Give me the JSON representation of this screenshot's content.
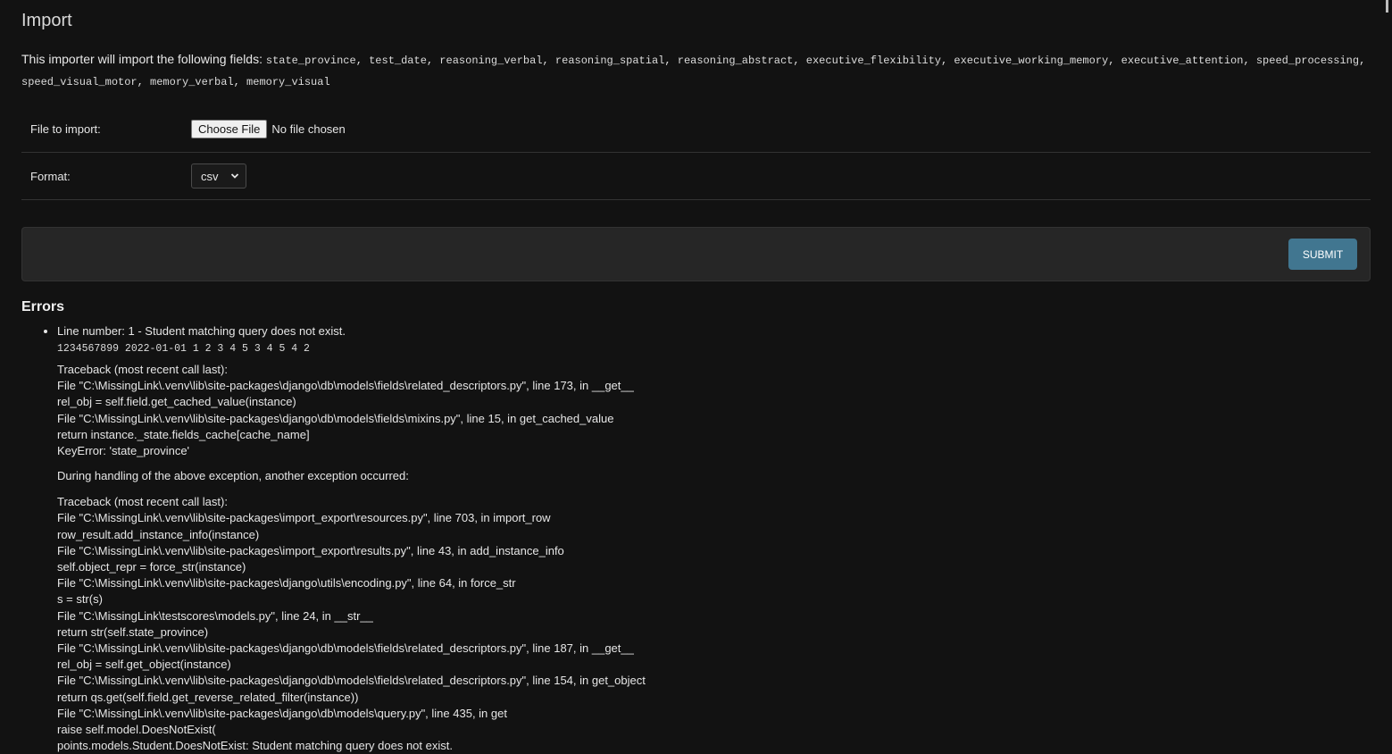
{
  "page": {
    "title": "Import"
  },
  "intro": {
    "text": "This importer will import the following fields: ",
    "fields": "state_province, test_date, reasoning_verbal, reasoning_spatial, reasoning_abstract, executive_flexibility, executive_working_memory, executive_attention, speed_processing, speed_visual_motor, memory_verbal, memory_visual"
  },
  "form": {
    "file_label": "File to import:",
    "file_button": "Choose File",
    "file_status": "No file chosen",
    "format_label": "Format:",
    "format_selected": "csv",
    "submit_label": "SUBMIT"
  },
  "colors": {
    "background": "#121212",
    "submit_button": "#417690",
    "panel": "#262626"
  },
  "errors": {
    "title": "Errors",
    "items": [
      {
        "message": "Line number: 1 - Student matching query does not exist.",
        "row_values": "1234567899 2022-01-01 1 2 3 4 5 3 4 5 4 2",
        "traceback1": [
          "Traceback (most recent call last):",
          "File \"C:\\MissingLink\\.venv\\lib\\site-packages\\django\\db\\models\\fields\\related_descriptors.py\", line 173, in __get__",
          "rel_obj = self.field.get_cached_value(instance)",
          "File \"C:\\MissingLink\\.venv\\lib\\site-packages\\django\\db\\models\\fields\\mixins.py\", line 15, in get_cached_value",
          "return instance._state.fields_cache[cache_name]",
          "KeyError: 'state_province'"
        ],
        "separator": "During handling of the above exception, another exception occurred:",
        "traceback2": [
          "Traceback (most recent call last):",
          "File \"C:\\MissingLink\\.venv\\lib\\site-packages\\import_export\\resources.py\", line 703, in import_row",
          "row_result.add_instance_info(instance)",
          "File \"C:\\MissingLink\\.venv\\lib\\site-packages\\import_export\\results.py\", line 43, in add_instance_info",
          "self.object_repr = force_str(instance)",
          "File \"C:\\MissingLink\\.venv\\lib\\site-packages\\django\\utils\\encoding.py\", line 64, in force_str",
          "s = str(s)",
          "File \"C:\\MissingLink\\testscores\\models.py\", line 24, in __str__",
          "return str(self.state_province)",
          "File \"C:\\MissingLink\\.venv\\lib\\site-packages\\django\\db\\models\\fields\\related_descriptors.py\", line 187, in __get__",
          "rel_obj = self.get_object(instance)",
          "File \"C:\\MissingLink\\.venv\\lib\\site-packages\\django\\db\\models\\fields\\related_descriptors.py\", line 154, in get_object",
          "return qs.get(self.field.get_reverse_related_filter(instance))",
          "File \"C:\\MissingLink\\.venv\\lib\\site-packages\\django\\db\\models\\query.py\", line 435, in get",
          "raise self.model.DoesNotExist(",
          "points.models.Student.DoesNotExist: Student matching query does not exist."
        ]
      }
    ]
  }
}
